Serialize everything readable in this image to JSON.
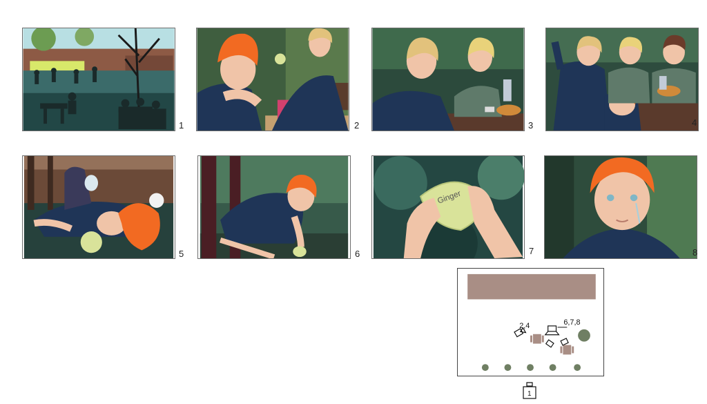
{
  "panels": [
    {
      "number": "1"
    },
    {
      "number": "2"
    },
    {
      "number": "3"
    },
    {
      "number": "4"
    },
    {
      "number": "5"
    },
    {
      "number": "6"
    },
    {
      "number": "7",
      "prop_text": "Ginger"
    },
    {
      "number": "8"
    }
  ],
  "floor_plan": {
    "camera_label_a": "2,4",
    "camera_label_b": "6,7,8",
    "camera_label_c": "1"
  },
  "colors": {
    "hair_orange": "#f26a22",
    "hair_blonde": "#e2c27c",
    "shirt_navy": "#1f3557",
    "shirt_green": "#5f7a6a",
    "skin": "#f0c4a8",
    "foliage_dark": "#1e3f3b",
    "building_brown": "#8a5a43",
    "plan_bar": "#a98e85",
    "plan_dot": "#6f7f63"
  }
}
